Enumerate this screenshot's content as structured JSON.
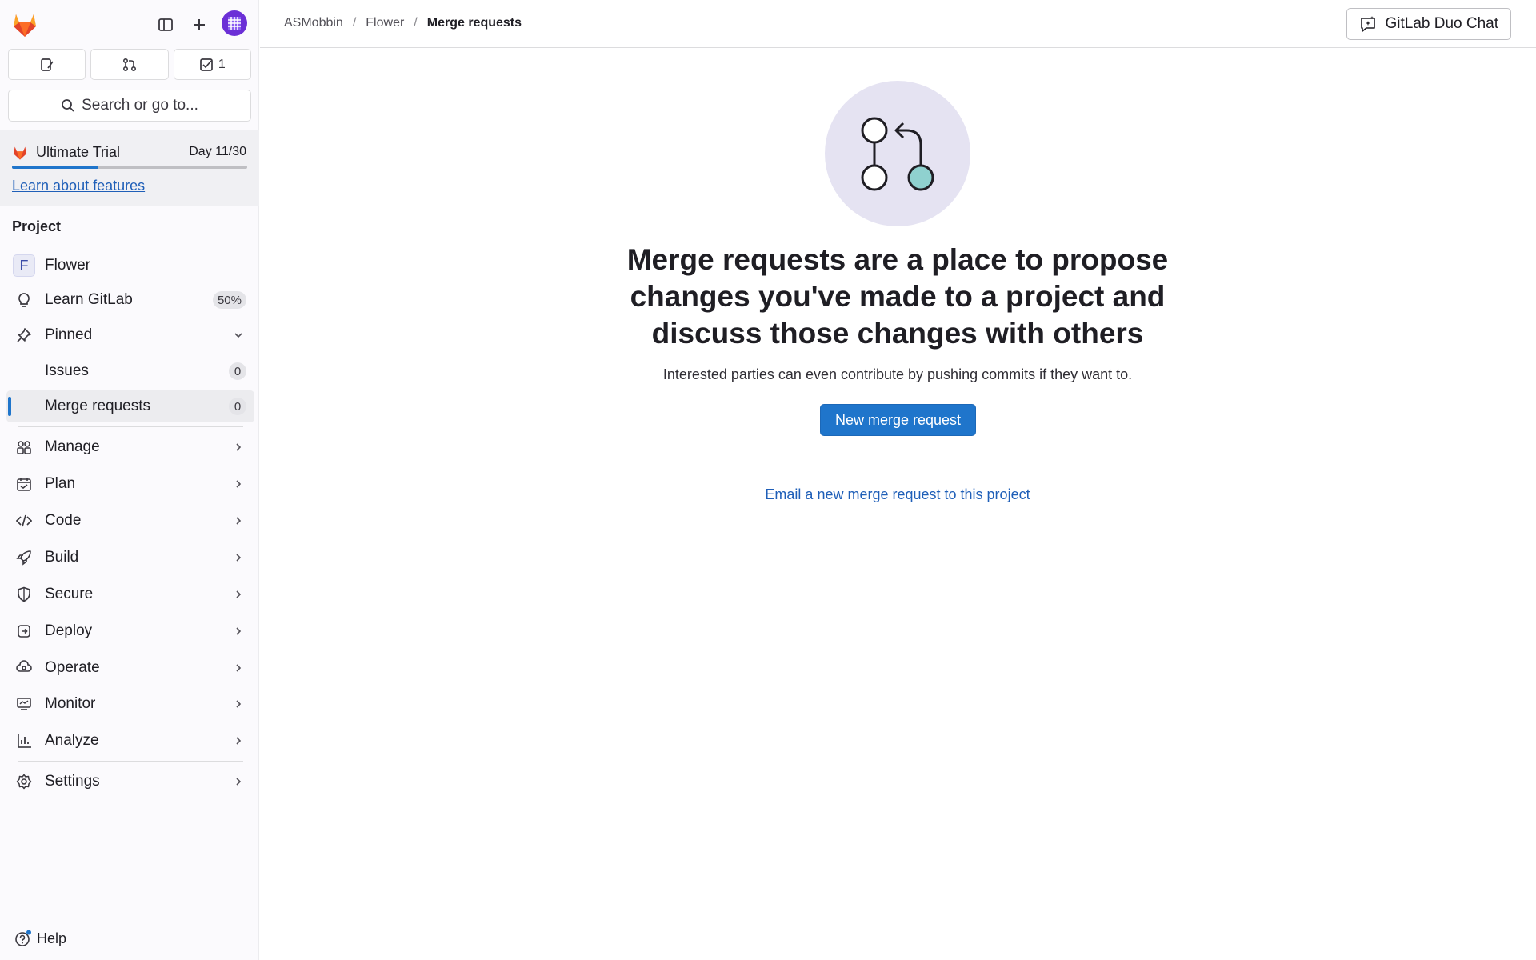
{
  "header": {
    "breadcrumbs": [
      "ASMobbin",
      "Flower",
      "Merge requests"
    ],
    "separator": "/",
    "duo_chat_label": "GitLab Duo Chat"
  },
  "sidebar": {
    "quick_buttons": [
      {
        "icon": "issues-icon",
        "label": ""
      },
      {
        "icon": "merge-request-icon",
        "label": ""
      },
      {
        "icon": "todo-icon",
        "label": "1"
      }
    ],
    "search_label": "Search or go to...",
    "trial": {
      "title": "Ultimate Trial",
      "day": "Day 11/30",
      "progress_fraction": 0.367,
      "link": "Learn about features"
    },
    "section_title": "Project",
    "project": {
      "letter": "F",
      "name": "Flower"
    },
    "learn": {
      "label": "Learn GitLab",
      "badge": "50%"
    },
    "pinned": {
      "label": "Pinned",
      "items": [
        {
          "label": "Issues",
          "count": "0"
        },
        {
          "label": "Merge requests",
          "count": "0"
        }
      ]
    },
    "menu": [
      {
        "label": "Manage",
        "icon": "manage-icon"
      },
      {
        "label": "Plan",
        "icon": "plan-icon"
      },
      {
        "label": "Code",
        "icon": "code-icon"
      },
      {
        "label": "Build",
        "icon": "build-icon"
      },
      {
        "label": "Secure",
        "icon": "secure-icon"
      },
      {
        "label": "Deploy",
        "icon": "deploy-icon"
      },
      {
        "label": "Operate",
        "icon": "operate-icon"
      },
      {
        "label": "Monitor",
        "icon": "monitor-icon"
      },
      {
        "label": "Analyze",
        "icon": "analyze-icon"
      }
    ],
    "settings_label": "Settings",
    "help_label": "Help"
  },
  "main": {
    "title_lines": [
      "Merge requests are a place to propose",
      "changes you've made to a project and",
      "discuss those changes with others"
    ],
    "description": "Interested parties can even contribute by pushing commits if they want to.",
    "new_button": "New merge request",
    "email_link": "Email a new merge request to this project"
  },
  "colors": {
    "accent": "#1f75cb",
    "link": "#1f5fb8",
    "brand_orange": "#e24329",
    "illustration_bg": "#e5e3f2",
    "illustration_node": "#8fd1cf"
  }
}
